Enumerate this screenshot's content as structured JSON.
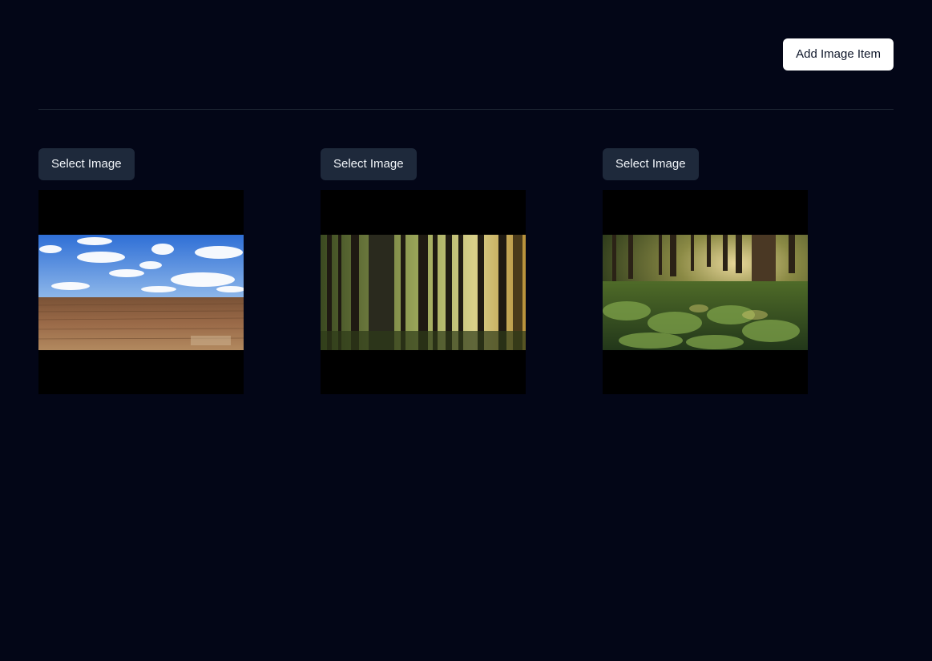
{
  "toolbar": {
    "add_label": "Add Image Item"
  },
  "items": [
    {
      "select_label": "Select Image",
      "image": "field-under-cloudy-sky"
    },
    {
      "select_label": "Select Image",
      "image": "tall-pine-forest"
    },
    {
      "select_label": "Select Image",
      "image": "sunlit-fern-forest"
    }
  ],
  "colors": {
    "background": "#030617",
    "divider": "#1e2533",
    "primary_button": "#ffffff",
    "secondary_button": "#1e293b"
  }
}
